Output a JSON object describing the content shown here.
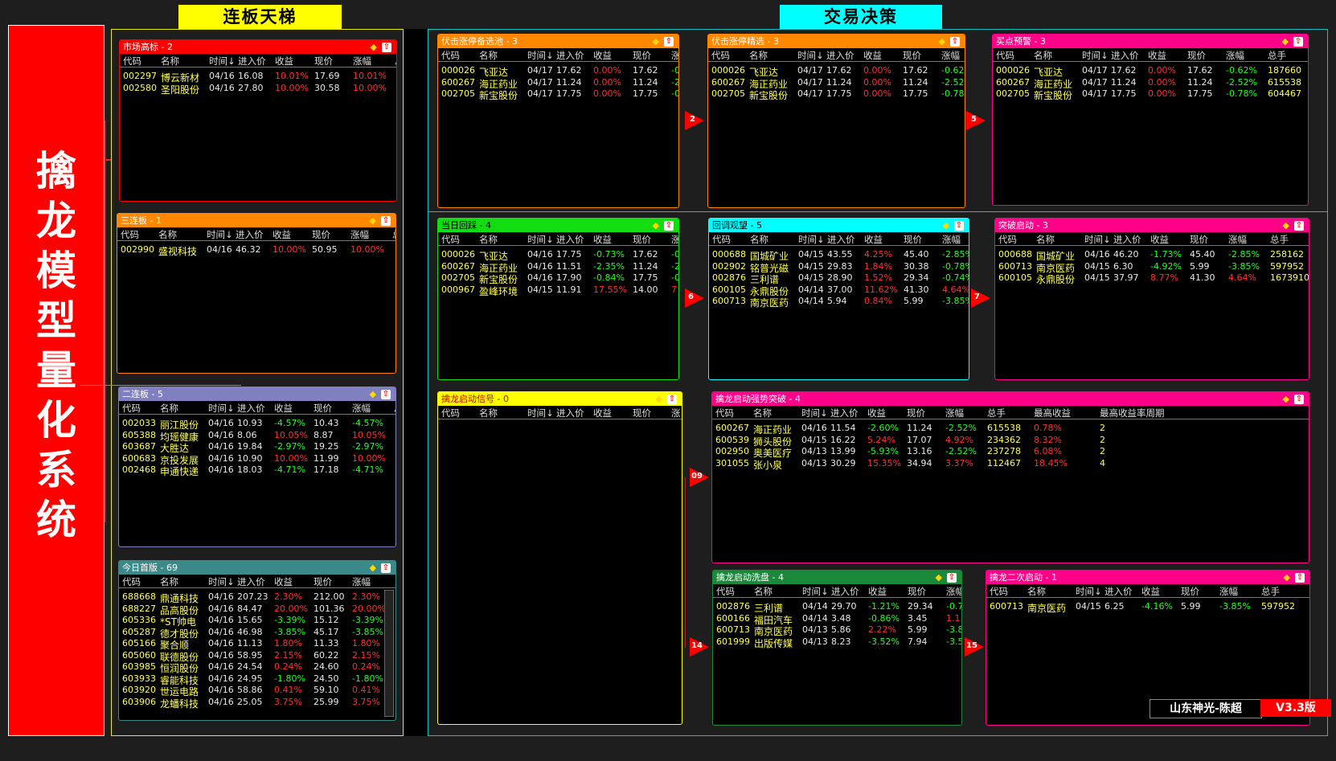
{
  "headers": {
    "ladder": "连板天梯",
    "decision": "交易决策"
  },
  "side_title": [
    "擒",
    "龙",
    "模",
    "型",
    "量",
    "化",
    "系",
    "统"
  ],
  "footer": {
    "author": "山东神光-陈超",
    "version": "V3.3版"
  },
  "colors": {
    "orange": "#ff8800",
    "red": "#ff0000",
    "green": "#11dd11",
    "cyan": "#00ffff",
    "pink": "#ff0088",
    "yellow": "#ffff00",
    "purple": "#8080c0",
    "teal": "#3a8a8a",
    "darkgreen": "#1a8a3a"
  },
  "panels": {
    "p_market": {
      "title": "市场高标 - 2",
      "cols": [
        "代码",
        "名称",
        "时间↓",
        "进入价",
        "收益",
        "现价",
        "涨幅",
        "总"
      ],
      "rows": [
        [
          "002297",
          "博云新材",
          "04/16",
          "16.08",
          "10.01%",
          "17.69",
          "10.01%"
        ],
        [
          "002580",
          "圣阳股份",
          "04/16",
          "27.80",
          "10.00%",
          "30.58",
          "10.00%"
        ]
      ]
    },
    "p_three": {
      "title": "三连板 - 1",
      "cols": [
        "代码",
        "名称",
        "时间↓",
        "进入价",
        "收益",
        "现价",
        "涨幅",
        "总"
      ],
      "rows": [
        [
          "002990",
          "盛视科技",
          "04/16",
          "46.32",
          "10.00%",
          "50.95",
          "10.00%"
        ]
      ]
    },
    "p_two": {
      "title": "二连板 - 5",
      "cols": [
        "代码",
        "名称",
        "时间↓",
        "进入价",
        "收益",
        "现价",
        "涨幅",
        "总"
      ],
      "rows": [
        [
          "002033",
          "丽江股份",
          "04/16",
          "10.93",
          "-4.57%",
          "10.43",
          "-4.57%"
        ],
        [
          "605388",
          "均瑶健康",
          "04/16",
          "8.06",
          "10.05%",
          "8.87",
          "10.05%"
        ],
        [
          "603687",
          "大胜达",
          "04/16",
          "19.84",
          "-2.97%",
          "19.25",
          "-2.97%"
        ],
        [
          "600683",
          "京投发展",
          "04/16",
          "10.90",
          "10.00%",
          "11.99",
          "10.00%"
        ],
        [
          "002468",
          "申通快递",
          "04/16",
          "18.03",
          "-4.71%",
          "17.18",
          "-4.71%"
        ]
      ]
    },
    "p_first": {
      "title": "今日首版 - 69",
      "cols": [
        "代码",
        "名称",
        "时间↓",
        "进入价",
        "收益",
        "现价",
        "涨幅"
      ],
      "rows": [
        [
          "688668",
          "鼎通科技",
          "04/16",
          "207.23",
          "2.30%",
          "212.00",
          "2.30%"
        ],
        [
          "688227",
          "品高股份",
          "04/16",
          "84.47",
          "20.00%",
          "101.36",
          "20.00%"
        ],
        [
          "605336",
          "*ST帅电",
          "04/16",
          "15.65",
          "-3.39%",
          "15.12",
          "-3.39%"
        ],
        [
          "605287",
          "德才股份",
          "04/16",
          "46.98",
          "-3.85%",
          "45.17",
          "-3.85%"
        ],
        [
          "605166",
          "聚合顺",
          "04/16",
          "11.13",
          "1.80%",
          "11.33",
          "1.80%"
        ],
        [
          "605060",
          "联德股份",
          "04/16",
          "58.95",
          "2.15%",
          "60.22",
          "2.15%"
        ],
        [
          "603985",
          "恒润股份",
          "04/16",
          "24.54",
          "0.24%",
          "24.60",
          "0.24%"
        ],
        [
          "603933",
          "睿能科技",
          "04/16",
          "24.95",
          "-1.80%",
          "24.50",
          "-1.80%"
        ],
        [
          "603920",
          "世运电路",
          "04/16",
          "58.86",
          "0.41%",
          "59.10",
          "0.41%"
        ],
        [
          "603906",
          "龙蟠科技",
          "04/16",
          "25.05",
          "3.75%",
          "25.99",
          "3.75%"
        ]
      ]
    },
    "p_pool": {
      "title": "伏击涨停备选池 - 3",
      "cols": [
        "代码",
        "名称",
        "时间↓",
        "进入价",
        "收益",
        "现价",
        "涨"
      ],
      "rows": [
        [
          "000026",
          "飞亚达",
          "04/17",
          "17.62",
          "0.00%",
          "17.62",
          "-0"
        ],
        [
          "600267",
          "海正药业",
          "04/17",
          "11.24",
          "0.00%",
          "11.24",
          "-2"
        ],
        [
          "002705",
          "新宝股份",
          "04/17",
          "17.75",
          "0.00%",
          "17.75",
          "-0"
        ]
      ]
    },
    "p_select": {
      "title": "伏击涨停精选 - 3",
      "cols": [
        "代码",
        "名称",
        "时间↓",
        "进入价",
        "收益",
        "现价",
        "涨幅"
      ],
      "rows": [
        [
          "000026",
          "飞亚达",
          "04/17",
          "17.62",
          "0.00%",
          "17.62",
          "-0.62%"
        ],
        [
          "600267",
          "海正药业",
          "04/17",
          "11.24",
          "0.00%",
          "11.24",
          "-2.52%"
        ],
        [
          "002705",
          "新宝股份",
          "04/17",
          "17.75",
          "0.00%",
          "17.75",
          "-0.78%"
        ]
      ]
    },
    "p_buy": {
      "title": "买点预警 - 3",
      "cols": [
        "代码",
        "名称",
        "时间↓",
        "进入价",
        "收益",
        "现价",
        "涨幅",
        "总手"
      ],
      "rows": [
        [
          "000026",
          "飞亚达",
          "04/17",
          "17.62",
          "0.00%",
          "17.62",
          "-0.62%",
          "187660"
        ],
        [
          "600267",
          "海正药业",
          "04/17",
          "11.24",
          "0.00%",
          "11.24",
          "-2.52%",
          "615538"
        ],
        [
          "002705",
          "新宝股份",
          "04/17",
          "17.75",
          "0.00%",
          "17.75",
          "-0.78%",
          "604467"
        ]
      ]
    },
    "p_back": {
      "title": "当日回踩 - 4",
      "cols": [
        "代码",
        "名称",
        "时间↓",
        "进入价",
        "收益",
        "现价",
        "涨"
      ],
      "rows": [
        [
          "000026",
          "飞亚达",
          "04/16",
          "17.75",
          "-0.73%",
          "17.62",
          "-0"
        ],
        [
          "600267",
          "海正药业",
          "04/16",
          "11.51",
          "-2.35%",
          "11.24",
          "-2"
        ],
        [
          "002705",
          "新宝股份",
          "04/16",
          "17.90",
          "-0.84%",
          "17.75",
          "-0"
        ],
        [
          "000967",
          "盈峰环境",
          "04/15",
          "11.91",
          "17.55%",
          "14.00",
          "7"
        ]
      ]
    },
    "p_pullback": {
      "title": "回调观望 - 5",
      "cols": [
        "代码",
        "名称",
        "时间↓",
        "进入价",
        "收益",
        "现价",
        "涨幅"
      ],
      "rows": [
        [
          "000688",
          "国城矿业",
          "04/15",
          "43.55",
          "4.25%",
          "45.40",
          "-2.85%"
        ],
        [
          "002902",
          "铭普光磁",
          "04/15",
          "29.83",
          "1.84%",
          "30.38",
          "-0.78%"
        ],
        [
          "002876",
          "三利谱",
          "04/15",
          "28.90",
          "1.52%",
          "29.34",
          "-0.74%"
        ],
        [
          "600105",
          "永鼎股份",
          "04/14",
          "37.00",
          "11.62%",
          "41.30",
          "4.64%"
        ],
        [
          "600713",
          "南京医药",
          "04/14",
          "5.94",
          "0.84%",
          "5.99",
          "-3.85%"
        ]
      ]
    },
    "p_break": {
      "title": "突破启动 - 3",
      "cols": [
        "代码",
        "名称",
        "时间↓",
        "进入价",
        "收益",
        "现价",
        "涨幅",
        "总手"
      ],
      "rows": [
        [
          "000688",
          "国城矿业",
          "04/16",
          "46.20",
          "-1.73%",
          "45.40",
          "-2.85%",
          "258162"
        ],
        [
          "600713",
          "南京医药",
          "04/15",
          "6.30",
          "-4.92%",
          "5.99",
          "-3.85%",
          "597952"
        ],
        [
          "600105",
          "永鼎股份",
          "04/15",
          "37.97",
          "8.77%",
          "41.30",
          "4.64%",
          "1673910"
        ]
      ]
    },
    "p_signal": {
      "title": "擒龙启动信号 - 0",
      "cols": [
        "代码",
        "名称",
        "时间↓",
        "进入价",
        "收益",
        "现价",
        "涨"
      ],
      "rows": []
    },
    "p_strong": {
      "title": "擒龙启动强势突破 - 4",
      "cols": [
        "代码",
        "名称",
        "时间↓",
        "进入价",
        "收益",
        "现价",
        "涨幅",
        "总手",
        "最高收益",
        "最高收益率周期"
      ],
      "rows": [
        [
          "600267",
          "海正药业",
          "04/16",
          "11.54",
          "-2.60%",
          "11.24",
          "-2.52%",
          "615538",
          "0.78%",
          "2"
        ],
        [
          "600539",
          "狮头股份",
          "04/15",
          "16.22",
          "5.24%",
          "17.07",
          "4.92%",
          "234362",
          "8.32%",
          "2"
        ],
        [
          "002950",
          "奥美医疗",
          "04/13",
          "13.99",
          "-5.93%",
          "13.16",
          "-2.52%",
          "237278",
          "6.08%",
          "2"
        ],
        [
          "301055",
          "张小泉",
          "04/13",
          "30.29",
          "15.35%",
          "34.94",
          "3.37%",
          "112467",
          "18.45%",
          "4"
        ]
      ]
    },
    "p_wash": {
      "title": "擒龙启动洗盘 - 4",
      "cols": [
        "代码",
        "名称",
        "时间↓",
        "进入价",
        "收益",
        "现价",
        "涨幅"
      ],
      "rows": [
        [
          "002876",
          "三利谱",
          "04/14",
          "29.70",
          "-1.21%",
          "29.34",
          "-0.7"
        ],
        [
          "600166",
          "福田汽车",
          "04/14",
          "3.48",
          "-0.86%",
          "3.45",
          "1.1"
        ],
        [
          "600713",
          "南京医药",
          "04/13",
          "5.86",
          "2.22%",
          "5.99",
          "-3.8"
        ],
        [
          "601999",
          "出版传媒",
          "04/13",
          "8.23",
          "-3.52%",
          "7.94",
          "-3.5"
        ]
      ]
    },
    "p_second": {
      "title": "擒龙二次启动 - 1",
      "cols": [
        "代码",
        "名称",
        "时间↓",
        "进入价",
        "收益",
        "现价",
        "涨幅",
        "总手"
      ],
      "rows": [
        [
          "600713",
          "南京医药",
          "04/15",
          "6.25",
          "-4.16%",
          "5.99",
          "-3.85%",
          "597952"
        ]
      ]
    }
  },
  "arrows": {
    "a2": "2",
    "a5": "5",
    "a6": "6",
    "a7": "7",
    "a9": "09",
    "a14": "14",
    "a15": "15"
  }
}
